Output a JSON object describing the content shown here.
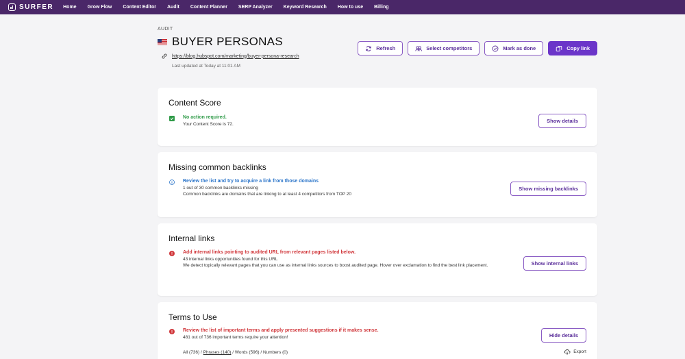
{
  "nav": {
    "logo_text": "SURFER",
    "items": [
      "Home",
      "Grow Flow",
      "Content Editor",
      "Audit",
      "Content Planner",
      "SERP Analyzer",
      "Keyword Research",
      "How to use",
      "Billing"
    ]
  },
  "header": {
    "breadcrumb": "AUDIT",
    "title": "BUYER PERSONAS",
    "url": "https://blog.hubspot.com/marketing/buyer-persona-research",
    "updated": "Last updated at Today at 11:01 AM"
  },
  "actions": {
    "refresh": "Refresh",
    "select_competitors": "Select competitors",
    "mark_done": "Mark as done",
    "copy_link": "Copy link"
  },
  "cards": {
    "content_score": {
      "title": "Content Score",
      "head": "No action required.",
      "line1": "Your Content Score is 72.",
      "button": "Show details"
    },
    "backlinks": {
      "title": "Missing common backlinks",
      "head": "Review the list and try to acquire a link from those domains",
      "line1": "1 out of 30 common backlinks missing",
      "line2": "Common backlinks are domains that are linking to at least 4 competitors from TOP 20",
      "button": "Show missing backlinks"
    },
    "internal_links": {
      "title": "Internal links",
      "head": "Add internal links pointing to audited URL from relevant pages listed below.",
      "line1": "43 internal links opportunities found for this URL",
      "line2": "We detect topically relevant pages that you can use as internal links sources to boost audited page. Hover over exclamation to find the best link placement.",
      "button": "Show internal links"
    },
    "terms": {
      "title": "Terms to Use",
      "head": "Review the list of important terms and apply presented suggestions if it makes sense.",
      "line1": "481 out of 736 important terms require your attention!",
      "button": "Hide details",
      "filter_all": "All (736)",
      "filter_sep": " / ",
      "filter_phrases": "Phrases (140)",
      "filter_words": "Words (596)",
      "filter_numbers": "Numbers (0)",
      "export": "Export"
    }
  },
  "colors": {
    "nav_bg": "#4a2768",
    "accent": "#6b35c9",
    "success": "#2e9a47",
    "info": "#2a74c9",
    "danger": "#d0363a"
  }
}
